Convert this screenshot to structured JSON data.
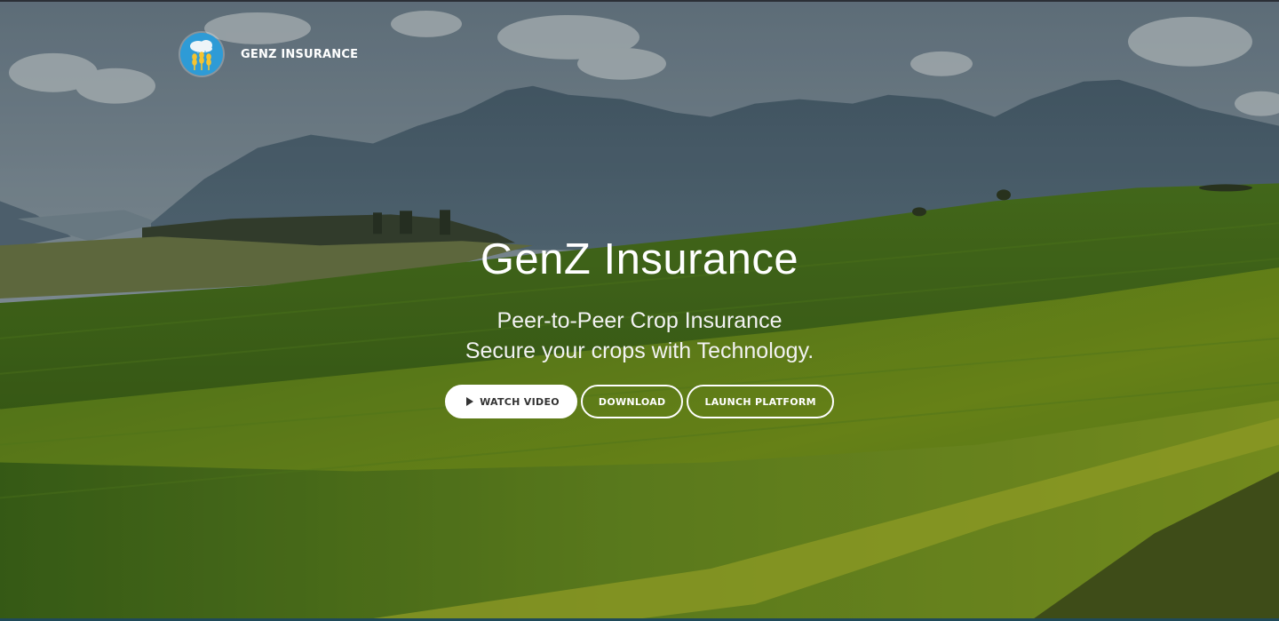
{
  "header": {
    "brand_name": "GENZ INSURANCE",
    "logo_icon": "cloud-wheat-logo"
  },
  "hero": {
    "title": "GenZ Insurance",
    "subtitle_line1": "Peer-to-Peer Crop Insurance",
    "subtitle_line2": "Secure your crops with Technology."
  },
  "buttons": {
    "watch_video": "WATCH VIDEO",
    "download": "DOWNLOAD",
    "launch_platform": "LAUNCH PLATFORM"
  },
  "colors": {
    "button_primary_bg": "#ffffff",
    "button_outline": "#ffffff",
    "logo_bg": "#2e9bd6",
    "field_green": "#4e7a1c",
    "mountain_blue": "#4f6678"
  }
}
